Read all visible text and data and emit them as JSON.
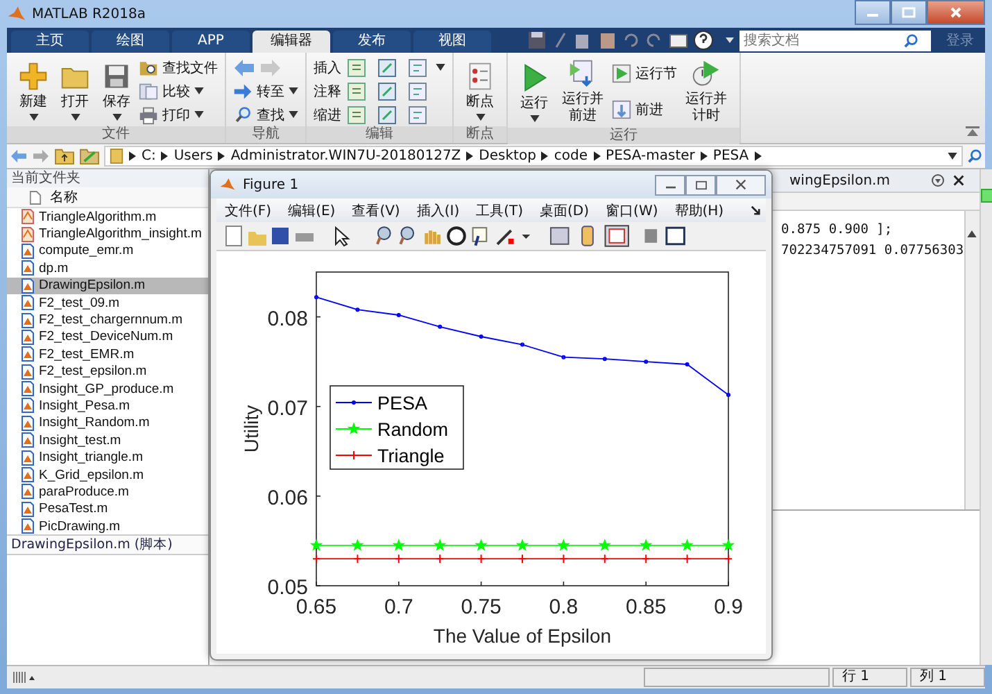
{
  "window": {
    "title": "MATLAB R2018a"
  },
  "tabs": [
    {
      "label": "主页",
      "selected": false
    },
    {
      "label": "绘图",
      "selected": false
    },
    {
      "label": "APP",
      "selected": false
    },
    {
      "label": "编辑器",
      "selected": true
    },
    {
      "label": "发布",
      "selected": false
    },
    {
      "label": "视图",
      "selected": false
    }
  ],
  "search": {
    "placeholder": "搜索文档"
  },
  "login": "登录",
  "ribbon": [
    {
      "label": "文件",
      "columns": [
        [
          {
            "kind": "large",
            "label": "新建",
            "caret": true
          }
        ],
        [
          {
            "kind": "large",
            "label": "打开",
            "caret": true
          }
        ],
        [
          {
            "kind": "large",
            "label": "保存",
            "caret": true
          }
        ],
        [
          {
            "kind": "small",
            "label": "查找文件",
            "caret": false
          },
          {
            "kind": "small",
            "label": "比较",
            "caret": true
          },
          {
            "kind": "small",
            "label": "打印",
            "caret": true
          }
        ]
      ]
    },
    {
      "label": "导航",
      "columns": [
        [
          {
            "kind": "arrows"
          },
          {
            "kind": "small",
            "label": "转至",
            "caret": true
          },
          {
            "kind": "small",
            "label": "查找",
            "caret": true
          }
        ]
      ]
    },
    {
      "label": "编辑",
      "columns": [
        [
          {
            "kind": "row",
            "label": "插入",
            "caret": true
          },
          {
            "kind": "row",
            "label": "注释",
            "caret": false
          },
          {
            "kind": "row",
            "label": "缩进",
            "caret": false
          }
        ]
      ]
    },
    {
      "label": "断点",
      "columns": [
        [
          {
            "kind": "large",
            "label": "断点",
            "caret": true
          }
        ]
      ]
    },
    {
      "label": "运行",
      "columns": [
        [
          {
            "kind": "large",
            "label": "运行",
            "caret": true
          }
        ],
        [
          {
            "kind": "large",
            "label": "运行并前进",
            "caret": false
          }
        ],
        [
          {
            "kind": "small",
            "label": "运行节",
            "caret": false
          },
          {
            "kind": "small",
            "label": "前进",
            "caret": false
          }
        ],
        [
          {
            "kind": "large",
            "label": "运行并计时",
            "caret": false
          }
        ]
      ]
    }
  ],
  "address": [
    "C:",
    "Users",
    "Administrator.WIN7U-20180127Z",
    "Desktop",
    "code",
    "PESA-master",
    "PESA"
  ],
  "current_folder": {
    "title": "当前文件夹",
    "column": "名称",
    "files": [
      {
        "name": "TriangleAlgorithm.m",
        "kind": "marked",
        "selected": false
      },
      {
        "name": "TriangleAlgorithm_insight.m",
        "kind": "marked",
        "selected": false
      },
      {
        "name": "compute_emr.m",
        "kind": "script",
        "selected": false
      },
      {
        "name": "dp.m",
        "kind": "script",
        "selected": false
      },
      {
        "name": "DrawingEpsilon.m",
        "kind": "script",
        "selected": true
      },
      {
        "name": "F2_test_09.m",
        "kind": "script",
        "selected": false
      },
      {
        "name": "F2_test_chargernnum.m",
        "kind": "script",
        "selected": false
      },
      {
        "name": "F2_test_DeviceNum.m",
        "kind": "script",
        "selected": false
      },
      {
        "name": "F2_test_EMR.m",
        "kind": "script",
        "selected": false
      },
      {
        "name": "F2_test_epsilon.m",
        "kind": "script",
        "selected": false
      },
      {
        "name": "Insight_GP_produce.m",
        "kind": "script",
        "selected": false
      },
      {
        "name": "Insight_Pesa.m",
        "kind": "script",
        "selected": false
      },
      {
        "name": "Insight_Random.m",
        "kind": "script",
        "selected": false
      },
      {
        "name": "Insight_test.m",
        "kind": "script",
        "selected": false
      },
      {
        "name": "Insight_triangle.m",
        "kind": "script",
        "selected": false
      },
      {
        "name": "K_Grid_epsilon.m",
        "kind": "script",
        "selected": false
      },
      {
        "name": "paraProduce.m",
        "kind": "script",
        "selected": false
      },
      {
        "name": "PesaTest.m",
        "kind": "script",
        "selected": false
      },
      {
        "name": "PicDrawing.m",
        "kind": "script",
        "selected": false
      }
    ],
    "details": "DrawingEpsilon.m  (脚本)"
  },
  "editor": {
    "tab": "wingEpsilon.m",
    "lines": [
      "0.875 0.900 ];",
      "702234757091 0.07756303"
    ]
  },
  "figure": {
    "title": "Figure 1",
    "menu": [
      "文件(F)",
      "编辑(E)",
      "查看(V)",
      "插入(I)",
      "工具(T)",
      "桌面(D)",
      "窗口(W)",
      "帮助(H)"
    ],
    "chart_data": {
      "type": "line",
      "xlabel": "The Value of Epsilon",
      "ylabel": "Utility",
      "x": [
        0.65,
        0.675,
        0.7,
        0.725,
        0.75,
        0.775,
        0.8,
        0.825,
        0.85,
        0.875,
        0.9
      ],
      "xlim": [
        0.65,
        0.9
      ],
      "ylim": [
        0.05,
        0.085
      ],
      "xticks": [
        0.65,
        0.7,
        0.75,
        0.8,
        0.85,
        0.9
      ],
      "yticks": [
        0.05,
        0.06,
        0.07,
        0.08
      ],
      "legend": true,
      "series": [
        {
          "name": "PESA",
          "color": "#0000ff",
          "marker": "circle",
          "values": [
            0.0822,
            0.0808,
            0.0802,
            0.0789,
            0.0778,
            0.0769,
            0.0755,
            0.0753,
            0.075,
            0.0747,
            0.0713
          ]
        },
        {
          "name": "Random",
          "color": "#00ff00",
          "marker": "star",
          "values": [
            0.0545,
            0.0545,
            0.0545,
            0.0545,
            0.0545,
            0.0545,
            0.0545,
            0.0545,
            0.0545,
            0.0545,
            0.0545
          ]
        },
        {
          "name": "Triangle",
          "color": "#ff0000",
          "marker": "cross",
          "values": [
            0.053,
            0.053,
            0.053,
            0.053,
            0.053,
            0.053,
            0.053,
            0.053,
            0.053,
            0.053,
            0.053
          ]
        }
      ]
    }
  },
  "status": {
    "row": "行 1",
    "col": "列 1"
  }
}
